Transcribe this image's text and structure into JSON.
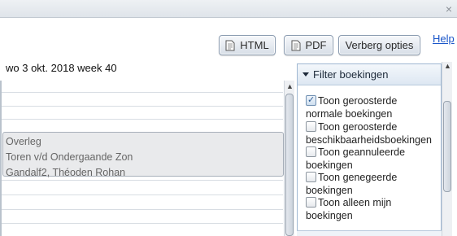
{
  "titlebar": {
    "close_label": "×"
  },
  "toolbar": {
    "html_label": "HTML",
    "pdf_label": "PDF",
    "verberg_label": "Verberg opties",
    "help_label": "Help"
  },
  "calendar": {
    "date_label": "wo 3 okt. 2018 week 40",
    "appointment": {
      "lines": [
        "Overleg",
        "Toren v/d Ondergaande Zon",
        "Gandalf2, Théoden Rohan"
      ]
    }
  },
  "filter": {
    "header": "Filter boekingen",
    "options": [
      {
        "line1": "Toon geroosterde",
        "line2": "normale boekingen",
        "checked": true
      },
      {
        "line1": "Toon geroosterde",
        "line2": "beschikbaarheidsboekingen",
        "checked": false
      },
      {
        "line1": "Toon geannuleerde",
        "line2": "boekingen",
        "checked": false
      },
      {
        "line1": "Toon genegeerde",
        "line2": "boekingen",
        "checked": false
      },
      {
        "line1": "Toon alleen mijn",
        "line2": "boekingen",
        "checked": false
      }
    ]
  },
  "icons": {
    "close": "close-icon",
    "document": "document-icon",
    "collapse": "triangle-down-icon",
    "checkmark": "checkmark-icon",
    "scroll_up": "arrow-up-icon",
    "scroll_down": "arrow-down-icon"
  },
  "colors": {
    "link": "#1a56c9",
    "panel_border": "#9fb7d2",
    "appointment_bg": "#e9eaec"
  }
}
